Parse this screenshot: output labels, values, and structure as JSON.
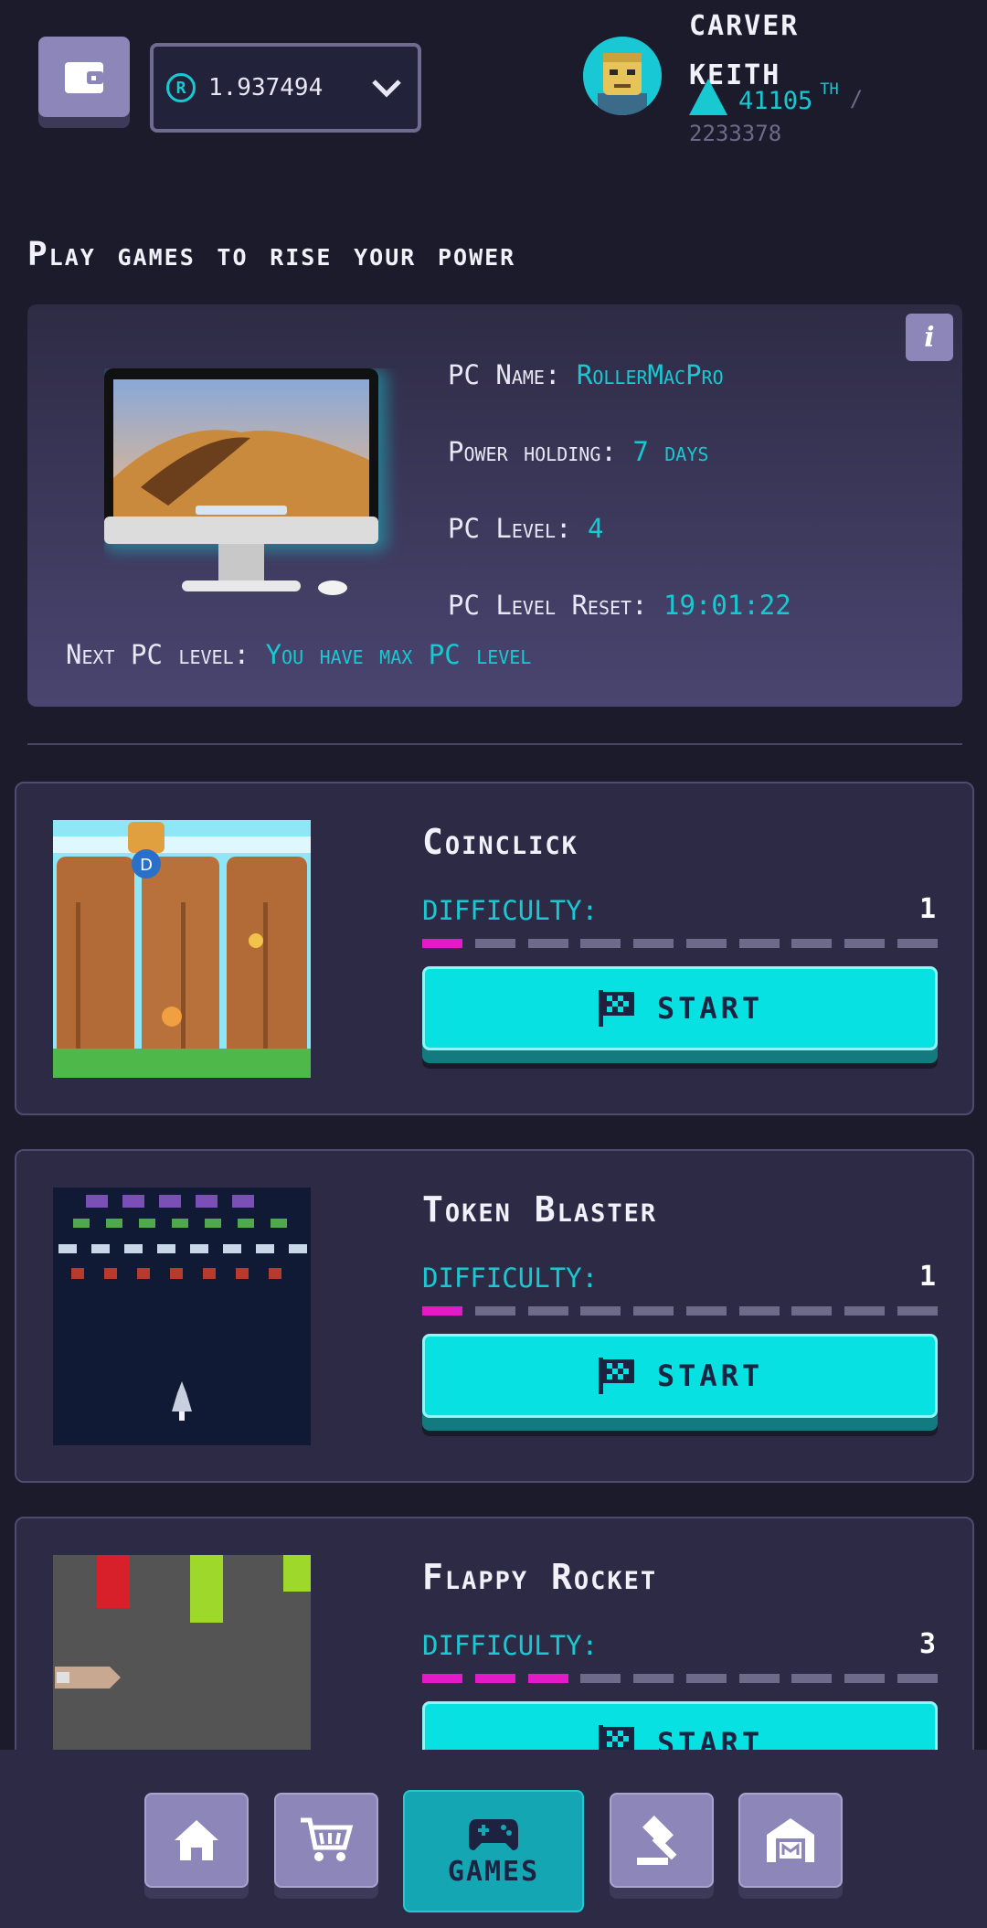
{
  "header": {
    "balance": "1.937494",
    "balance_coin_symbol": "R",
    "user": {
      "first_name": "CARVER",
      "last_name": "KEITH",
      "power": "41105",
      "power_unit": "TH",
      "power_separator": "/",
      "power_total": "2233378"
    }
  },
  "section_title": "Play games to rise your power",
  "pc_card": {
    "name_label": "PC Name:",
    "name_value": "RollerMacPro",
    "holding_label": "Power holding:",
    "holding_value": "7 days",
    "level_label": "PC Level:",
    "level_value": "4",
    "reset_label": "PC Level Reset:",
    "reset_value": "19:01:22",
    "next_label": "Next PC level:",
    "next_value": "You have max PC level",
    "info_icon_glyph": "i"
  },
  "games": [
    {
      "title": "Coinclick",
      "difficulty_label": "DIFFICULTY:",
      "difficulty": 1,
      "difficulty_max": 10,
      "start_label": "START"
    },
    {
      "title": "Token Blaster",
      "difficulty_label": "DIFFICULTY:",
      "difficulty": 1,
      "difficulty_max": 10,
      "start_label": "START"
    },
    {
      "title": "Flappy Rocket",
      "difficulty_label": "DIFFICULTY:",
      "difficulty": 3,
      "difficulty_max": 10,
      "start_label": "START"
    }
  ],
  "nav": {
    "items": [
      {
        "icon": "home-icon"
      },
      {
        "icon": "cart-icon"
      },
      {
        "icon": "gamepad-icon",
        "label": "GAMES",
        "active": true
      },
      {
        "icon": "gavel-icon"
      },
      {
        "icon": "warehouse-icon"
      }
    ]
  },
  "colors": {
    "accent": "#18c9d2",
    "difficulty_on": "#e419c7",
    "difficulty_off": "#6e6a8a",
    "start_button": "#08e1e1"
  }
}
